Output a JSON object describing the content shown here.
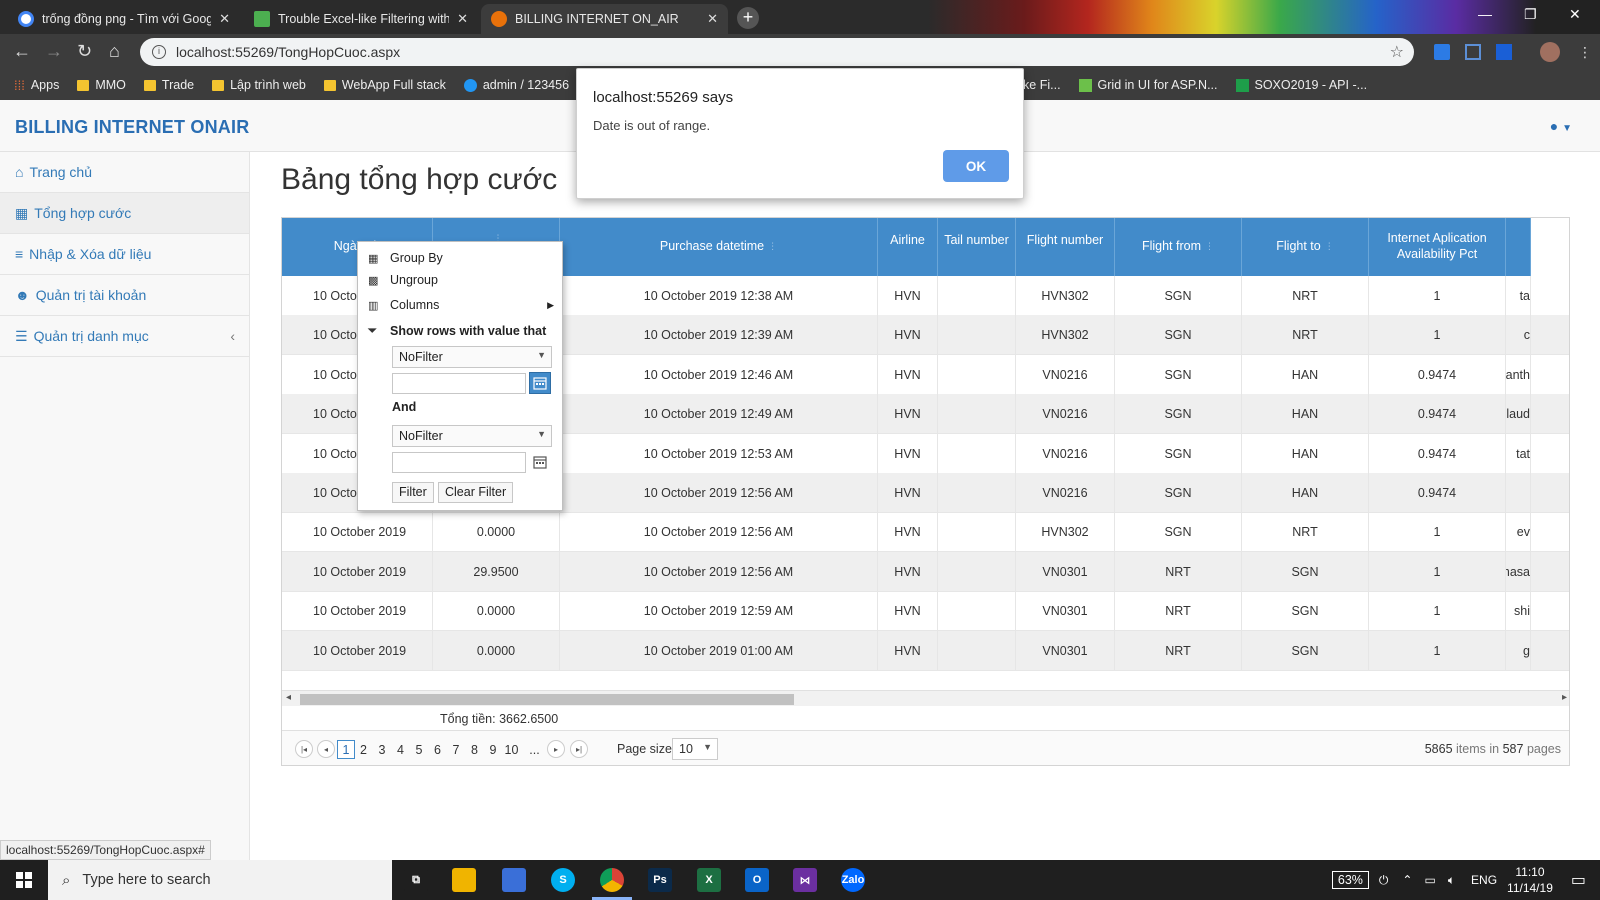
{
  "browser": {
    "tabs": [
      {
        "title": "trống đồng png - Tìm với Google",
        "favicon_color": "#4285f4",
        "active": false
      },
      {
        "title": "Trouble Excel-like Filtering with G",
        "favicon_color": "#4caf50",
        "active": false
      },
      {
        "title": "BILLING INTERNET ON_AIR",
        "favicon_color": "#e8710a",
        "active": true
      }
    ],
    "new_tab": "+",
    "url": "localhost:55269/TongHopCuoc.aspx",
    "bookmarks": [
      {
        "label": "Apps",
        "kind": "apps"
      },
      {
        "label": "MMO",
        "kind": "folder"
      },
      {
        "label": "Trade",
        "kind": "folder"
      },
      {
        "label": "Lập trình web",
        "kind": "folder"
      },
      {
        "label": "WebApp Full stack",
        "kind": "folder"
      },
      {
        "label": "admin / 123456",
        "kind": "site"
      },
      {
        "label": "ke Fi...",
        "kind": "site"
      },
      {
        "label": "Grid in UI for ASP.N...",
        "kind": "site"
      },
      {
        "label": "SOXO2019 - API -...",
        "kind": "site"
      }
    ],
    "status_url": "localhost:55269/TongHopCuoc.aspx#"
  },
  "app": {
    "brand": "BILLING INTERNET ONAIR",
    "user_icon": "user-icon",
    "sidebar": [
      {
        "icon": "home-icon",
        "glyph": "⌂",
        "label": "Trang chủ",
        "active": false
      },
      {
        "icon": "grid-icon",
        "glyph": "▦",
        "label": "Tổng hợp cước",
        "active": true
      },
      {
        "icon": "database-icon",
        "glyph": "≡",
        "label": "Nhập & Xóa dữ liệu",
        "active": false
      },
      {
        "icon": "users-icon",
        "glyph": "☻",
        "label": "Quản trị tài khoản",
        "active": false
      },
      {
        "icon": "list-icon",
        "glyph": "☰",
        "label": "Quản trị danh mục",
        "active": false,
        "has_submenu": true
      }
    ]
  },
  "page": {
    "title": "Bảng tổng hợp cước",
    "grid": {
      "columns": [
        "Ngày nh",
        "",
        "Purchase datetime",
        "Airline",
        "Tail number",
        "Flight number",
        "Flight from",
        "Flight to",
        "Internet Aplication Availability Pct",
        ""
      ],
      "rows": [
        {
          "date": "10 Octol",
          "price": "",
          "purchase": "10 October 2019 12:38 AM",
          "airline": "HVN",
          "tail": "",
          "flight": "HVN302",
          "from": "SGN",
          "to": "NRT",
          "pct": "1",
          "extra": "ta"
        },
        {
          "date": "10 Octol",
          "price": "",
          "purchase": "10 October 2019 12:39 AM",
          "airline": "HVN",
          "tail": "",
          "flight": "HVN302",
          "from": "SGN",
          "to": "NRT",
          "pct": "1",
          "extra": "c"
        },
        {
          "date": "10 Octol",
          "price": "",
          "purchase": "10 October 2019 12:46 AM",
          "airline": "HVN",
          "tail": "",
          "flight": "VN0216",
          "from": "SGN",
          "to": "HAN",
          "pct": "0.9474",
          "extra": "anth"
        },
        {
          "date": "10 Octol",
          "price": "",
          "purchase": "10 October 2019 12:49 AM",
          "airline": "HVN",
          "tail": "",
          "flight": "VN0216",
          "from": "SGN",
          "to": "HAN",
          "pct": "0.9474",
          "extra": "claud"
        },
        {
          "date": "10 Octol",
          "price": "",
          "purchase": "10 October 2019 12:53 AM",
          "airline": "HVN",
          "tail": "",
          "flight": "VN0216",
          "from": "SGN",
          "to": "HAN",
          "pct": "0.9474",
          "extra": "tat"
        },
        {
          "date": "10 Octol",
          "price": "",
          "purchase": "10 October 2019 12:56 AM",
          "airline": "HVN",
          "tail": "",
          "flight": "VN0216",
          "from": "SGN",
          "to": "HAN",
          "pct": "0.9474",
          "extra": ""
        },
        {
          "date": "10 October 2019",
          "price": "0.0000",
          "purchase": "10 October 2019 12:56 AM",
          "airline": "HVN",
          "tail": "",
          "flight": "HVN302",
          "from": "SGN",
          "to": "NRT",
          "pct": "1",
          "extra": "ev"
        },
        {
          "date": "10 October 2019",
          "price": "29.9500",
          "purchase": "10 October 2019 12:56 AM",
          "airline": "HVN",
          "tail": "",
          "flight": "VN0301",
          "from": "NRT",
          "to": "SGN",
          "pct": "1",
          "extra": "masa"
        },
        {
          "date": "10 October 2019",
          "price": "0.0000",
          "purchase": "10 October 2019 12:59 AM",
          "airline": "HVN",
          "tail": "",
          "flight": "VN0301",
          "from": "NRT",
          "to": "SGN",
          "pct": "1",
          "extra": "shi"
        },
        {
          "date": "10 October 2019",
          "price": "0.0000",
          "purchase": "10 October 2019 01:00 AM",
          "airline": "HVN",
          "tail": "",
          "flight": "VN0301",
          "from": "NRT",
          "to": "SGN",
          "pct": "1",
          "extra": "g"
        }
      ],
      "total": "Tổng tiền: 3662.6500",
      "pager": {
        "pages": [
          "1",
          "2",
          "3",
          "4",
          "5",
          "6",
          "7",
          "8",
          "9",
          "10",
          "..."
        ],
        "current": "1",
        "page_size_label": "Page size:",
        "page_size": "10",
        "items": "5865",
        "items_word": "items in",
        "pages_total": "587",
        "pages_word": "pages"
      }
    },
    "filter_menu": {
      "group_by": "Group By",
      "ungroup": "Ungroup",
      "columns": "Columns",
      "show_rows": "Show rows with value that",
      "first_op": "NoFilter",
      "and_label": "And",
      "second_op": "NoFilter",
      "filter_btn": "Filter",
      "clear_btn": "Clear Filter"
    }
  },
  "alert": {
    "title": "localhost:55269 says",
    "message": "Date is out of range.",
    "ok": "OK"
  },
  "taskbar": {
    "search_placeholder": "Type here to search",
    "battery": "63%",
    "lang": "ENG",
    "time": "11:10",
    "date": "11/14/19",
    "apps": [
      {
        "icon": "task-view-icon",
        "color": "#1f1f1f",
        "glyph": "⧉"
      },
      {
        "icon": "file-explorer-icon",
        "color": "#f0b400",
        "glyph": ""
      },
      {
        "icon": "store-icon",
        "color": "#3a6fd8",
        "glyph": ""
      },
      {
        "icon": "skype-icon",
        "color": "#00aff0",
        "glyph": "S"
      },
      {
        "icon": "chrome-icon",
        "color": "#db4437",
        "glyph": ""
      },
      {
        "icon": "photoshop-icon",
        "color": "#0b2a4a",
        "glyph": "Ps"
      },
      {
        "icon": "excel-icon",
        "color": "#1d6f42",
        "glyph": "X"
      },
      {
        "icon": "outlook-icon",
        "color": "#0a64c8",
        "glyph": "O"
      },
      {
        "icon": "visual-studio-icon",
        "color": "#6b2fa0",
        "glyph": "⋈"
      },
      {
        "icon": "zalo-icon",
        "color": "#0068ff",
        "glyph": "Zalo"
      }
    ]
  }
}
